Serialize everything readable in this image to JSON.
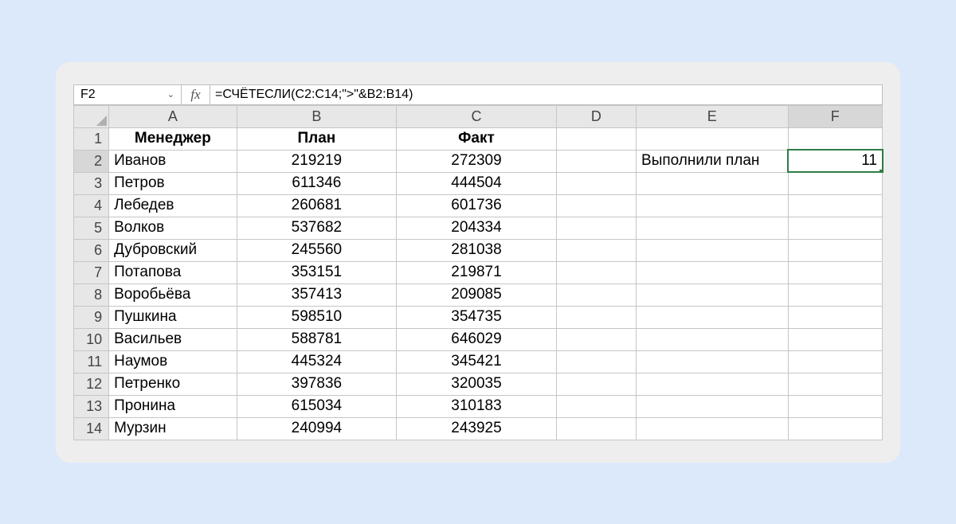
{
  "nameBox": "F2",
  "fxLabel": "fx",
  "formula": "=СЧЁТЕСЛИ(C2:C14;\">\"&B2:B14)",
  "columns": [
    "A",
    "B",
    "C",
    "D",
    "E",
    "F"
  ],
  "selectedCol": "F",
  "selectedRow": 2,
  "headers": {
    "A": "Менеджер",
    "B": "План",
    "C": "Факт"
  },
  "rows": [
    {
      "n": 1
    },
    {
      "n": 2,
      "A": "Иванов",
      "B": "219219",
      "C": "272309",
      "E": "Выполнили план",
      "F": "11"
    },
    {
      "n": 3,
      "A": "Петров",
      "B": "611346",
      "C": "444504"
    },
    {
      "n": 4,
      "A": "Лебедев",
      "B": "260681",
      "C": "601736"
    },
    {
      "n": 5,
      "A": "Волков",
      "B": "537682",
      "C": "204334"
    },
    {
      "n": 6,
      "A": "Дубровский",
      "B": "245560",
      "C": "281038"
    },
    {
      "n": 7,
      "A": "Потапова",
      "B": "353151",
      "C": "219871"
    },
    {
      "n": 8,
      "A": "Воробьёва",
      "B": "357413",
      "C": "209085"
    },
    {
      "n": 9,
      "A": "Пушкина",
      "B": "598510",
      "C": "354735"
    },
    {
      "n": 10,
      "A": "Васильев",
      "B": "588781",
      "C": "646029"
    },
    {
      "n": 11,
      "A": "Наумов",
      "B": "445324",
      "C": "345421"
    },
    {
      "n": 12,
      "A": "Петренко",
      "B": "397836",
      "C": "320035"
    },
    {
      "n": 13,
      "A": "Пронина",
      "B": "615034",
      "C": "310183"
    },
    {
      "n": 14,
      "A": "Мурзин",
      "B": "240994",
      "C": "243925"
    }
  ]
}
